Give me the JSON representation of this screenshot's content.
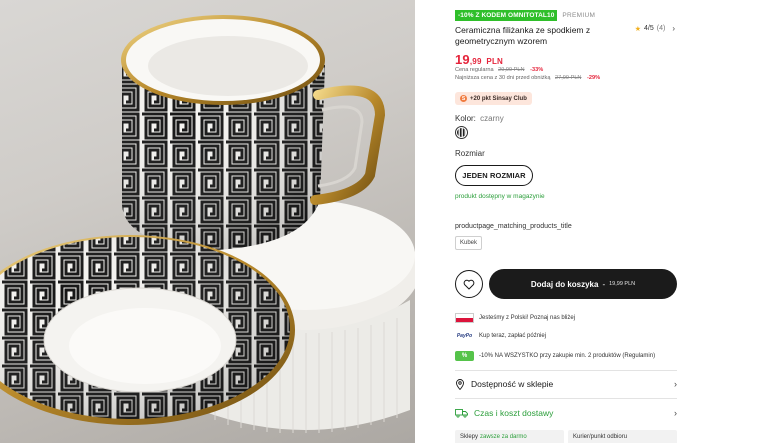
{
  "product": {
    "promo_badge": "-10% Z KODEM OMNITOTAL10",
    "premium_label": "PREMIUM",
    "title": "Ceramiczna filiżanka ze spodkiem z geometrycznym wzorem",
    "rating": {
      "value": "4/5",
      "count": "(4)"
    },
    "price": {
      "main": "19",
      "cents": ",99",
      "currency": "PLN"
    },
    "regular_price": {
      "label": "Cena regularna",
      "old": "29,99 PLN",
      "discount": "-33%"
    },
    "lowest_price": {
      "label": "Najniższa cena z 30 dni przed obniżką",
      "old": "27,99 PLN",
      "discount": "-29%"
    },
    "club": "+20 pkt Sinsay Club"
  },
  "options": {
    "color_label": "Kolor:",
    "color_value": "czarny",
    "size_label": "Rozmiar",
    "size_button": "JEDEN ROZMIAR",
    "store_availability": "produkt dostępny w magazynie"
  },
  "matching": {
    "title": "productpage_matching_products_title",
    "tag": "Kubek"
  },
  "cart": {
    "label": "Dodaj do koszyka",
    "separator": "-",
    "price": "19,99 PLN"
  },
  "info": [
    "Jesteśmy z Polski! Poznaj nas bliżej",
    "Kup teraz, zapłać później",
    "-10% NA WSZYSTKO przy zakupie min. 2 produktów (Regulamin)"
  ],
  "paypal_label": "PayPo",
  "accordion": {
    "availability": "Dostępność w sklepie",
    "delivery": "Czas i koszt dostawy"
  },
  "shipping": [
    {
      "name": "Sklepy",
      "note": "zawsze za darmo"
    },
    {
      "name": "Kurier/punkt odbioru",
      "note": ""
    }
  ],
  "colors": {
    "promo_green": "#2fbf2a",
    "price_red": "#e5243b",
    "success_green": "#2b9e3a",
    "button_dark": "#1b1b1b"
  }
}
